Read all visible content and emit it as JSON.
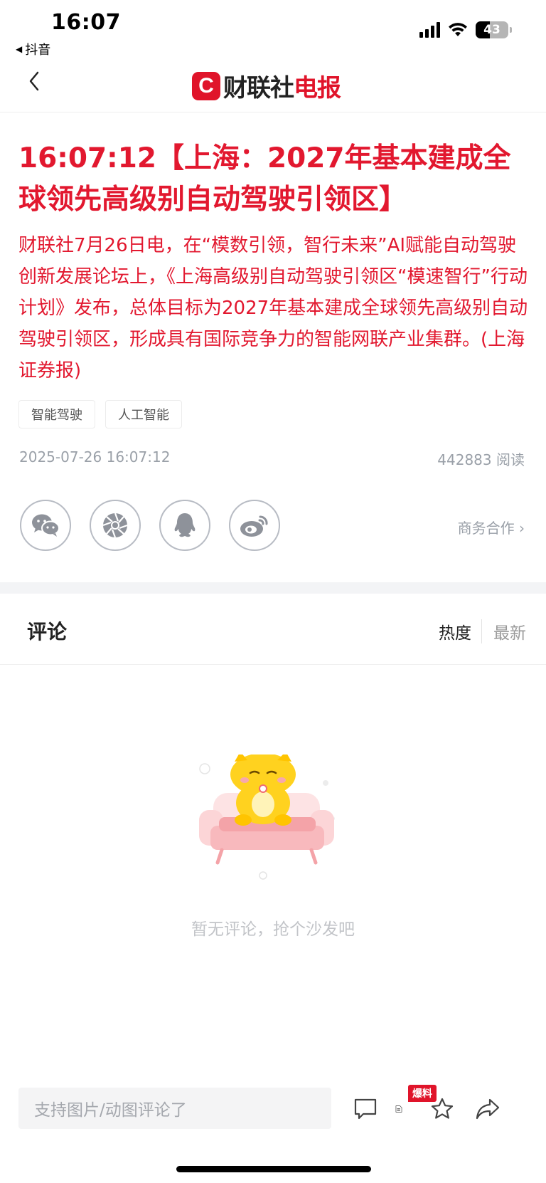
{
  "status_bar": {
    "time": "16:07",
    "back_app": "抖音",
    "battery": "43"
  },
  "nav": {
    "logo_mark": "C",
    "logo_text_black": "财联社",
    "logo_text_red": "电报"
  },
  "article": {
    "title": "16:07:12【上海：2027年基本建成全球领先高级别自动驾驶引领区】",
    "body": "财联社7月26日电，在“模数引领，智行未来”AI赋能自动驾驶创新发展论坛上，《上海高级别自动驾驶引领区“模速智行”行动计划》发布，总体目标为2027年基本建成全球领先高级别自动驾驶引领区，形成具有国际竞争力的智能网联产业集群。(上海证券报)",
    "tags": [
      "智能驾驶",
      "人工智能"
    ],
    "date": "2025-07-26 16:07:12",
    "reads": "442883 阅读",
    "business_link": "商务合作 ›"
  },
  "share": {
    "icons": [
      "wechat-icon",
      "moments-icon",
      "qq-icon",
      "weibo-icon"
    ]
  },
  "comments": {
    "title": "评论",
    "sort_hot": "热度",
    "sort_new": "最新",
    "empty_text": "暂无评论，抢个沙发吧"
  },
  "bottom_bar": {
    "input_placeholder": "支持图片/动图评论了",
    "baoliao_badge": "爆料"
  },
  "colors": {
    "accent": "#e2182f",
    "muted": "#9aa0a8"
  }
}
